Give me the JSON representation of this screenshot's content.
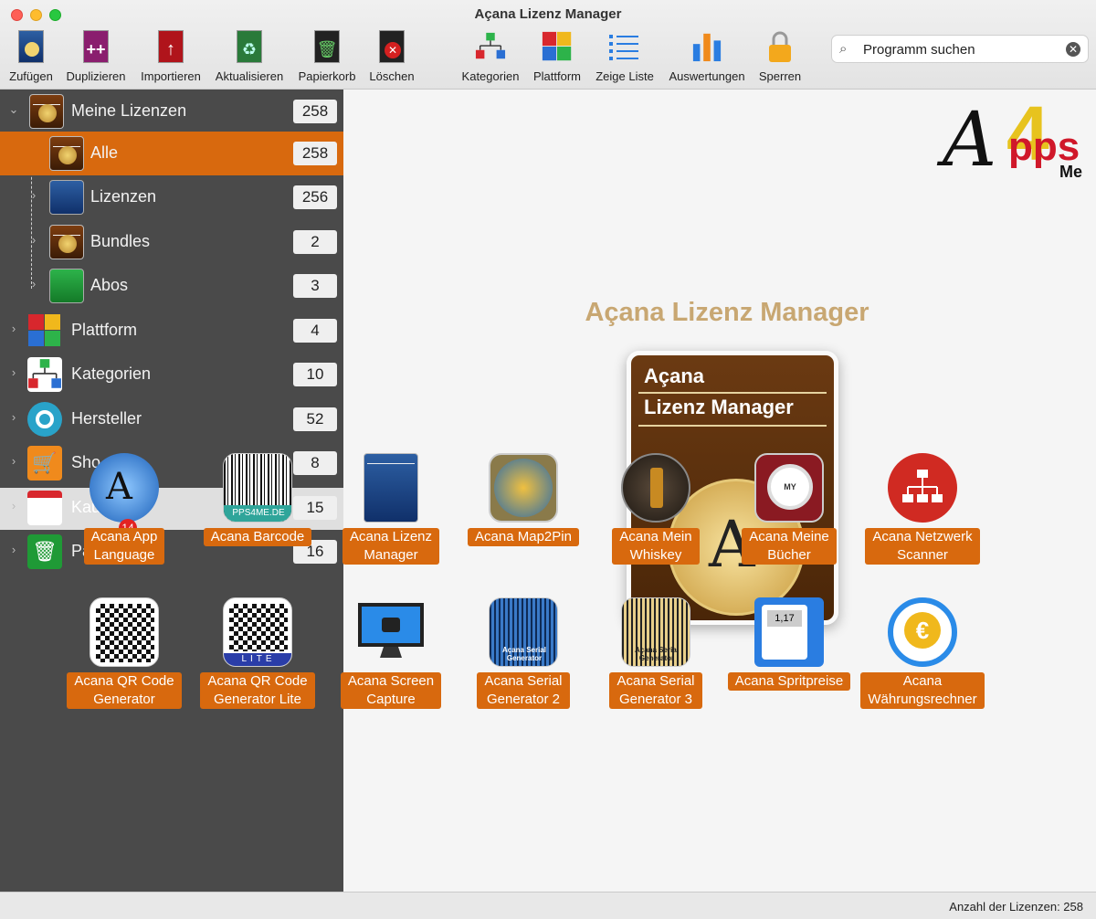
{
  "window": {
    "title": "Açana Lizenz Manager"
  },
  "toolbar": {
    "items": [
      {
        "label": "Zufügen",
        "icon": "add-license-icon"
      },
      {
        "label": "Duplizieren",
        "icon": "duplicate-icon"
      },
      {
        "label": "Importieren",
        "icon": "import-icon"
      },
      {
        "label": "Aktualisieren",
        "icon": "refresh-icon"
      },
      {
        "label": "Papierkorb",
        "icon": "trash-icon"
      },
      {
        "label": "Löschen",
        "icon": "delete-icon"
      },
      {
        "label": "Kategorien",
        "icon": "categories-icon"
      },
      {
        "label": "Plattform",
        "icon": "platform-icon"
      },
      {
        "label": "Zeige Liste",
        "icon": "list-icon"
      },
      {
        "label": "Auswertungen",
        "icon": "statistics-icon"
      },
      {
        "label": "Sperren",
        "icon": "lock-icon"
      }
    ]
  },
  "search": {
    "placeholder": "Programm suchen",
    "value": "Programm suchen"
  },
  "sidebar": {
    "items": [
      {
        "label": "Meine Lizenzen",
        "count": "258"
      },
      {
        "label": "Alle",
        "count": "258"
      },
      {
        "label": "Lizenzen",
        "count": "256"
      },
      {
        "label": "Bundles",
        "count": "2"
      },
      {
        "label": "Abos",
        "count": "3"
      },
      {
        "label": "Plattform",
        "count": "4"
      },
      {
        "label": "Kategorien",
        "count": "10"
      },
      {
        "label": "Hersteller",
        "count": "52"
      },
      {
        "label": "Sho",
        "count": "8"
      },
      {
        "label": "Kau",
        "count": "15"
      },
      {
        "label": "Pa",
        "count": "16"
      }
    ]
  },
  "hero": {
    "title": "Açana Lizenz Manager",
    "card_line1": "Açana",
    "card_line2": "Lizenz Manager",
    "logo_text": "Apps4Me"
  },
  "apps": [
    {
      "line1": "Acana App",
      "line2": "Language",
      "badge": "14"
    },
    {
      "line1": "Acana Barcode",
      "line2": ""
    },
    {
      "line1": "Acana Lizenz",
      "line2": "Manager"
    },
    {
      "line1": "Acana Map2Pin",
      "line2": ""
    },
    {
      "line1": "Acana Mein",
      "line2": "Whiskey"
    },
    {
      "line1": "Acana Meine",
      "line2": "Bücher"
    },
    {
      "line1": "Acana Netzwerk",
      "line2": "Scanner"
    },
    {
      "line1": "Acana QR Code",
      "line2": "Generator"
    },
    {
      "line1": "Acana QR Code",
      "line2": "Generator Lite"
    },
    {
      "line1": "Acana Screen",
      "line2": "Capture"
    },
    {
      "line1": "Acana Serial",
      "line2": "Generator 2"
    },
    {
      "line1": "Acana Serial",
      "line2": "Generator 3"
    },
    {
      "line1": "Acana Spritpreise",
      "line2": ""
    },
    {
      "line1": "Acana",
      "line2": "Währungsrechner"
    }
  ],
  "icon_texts": {
    "barcode_tag": "PPS4ME.DE",
    "lite_tag": "LITE",
    "serial_tag": "Açana Serial Generator",
    "price_tag": "1,17",
    "books_tag": "MY BOOKS"
  },
  "status": {
    "text": "Anzahl der Lizenzen: 258"
  },
  "colors": {
    "accent": "#d8690e",
    "sidebar_bg": "#4a4a4a",
    "hero_title": "#c8a772"
  }
}
